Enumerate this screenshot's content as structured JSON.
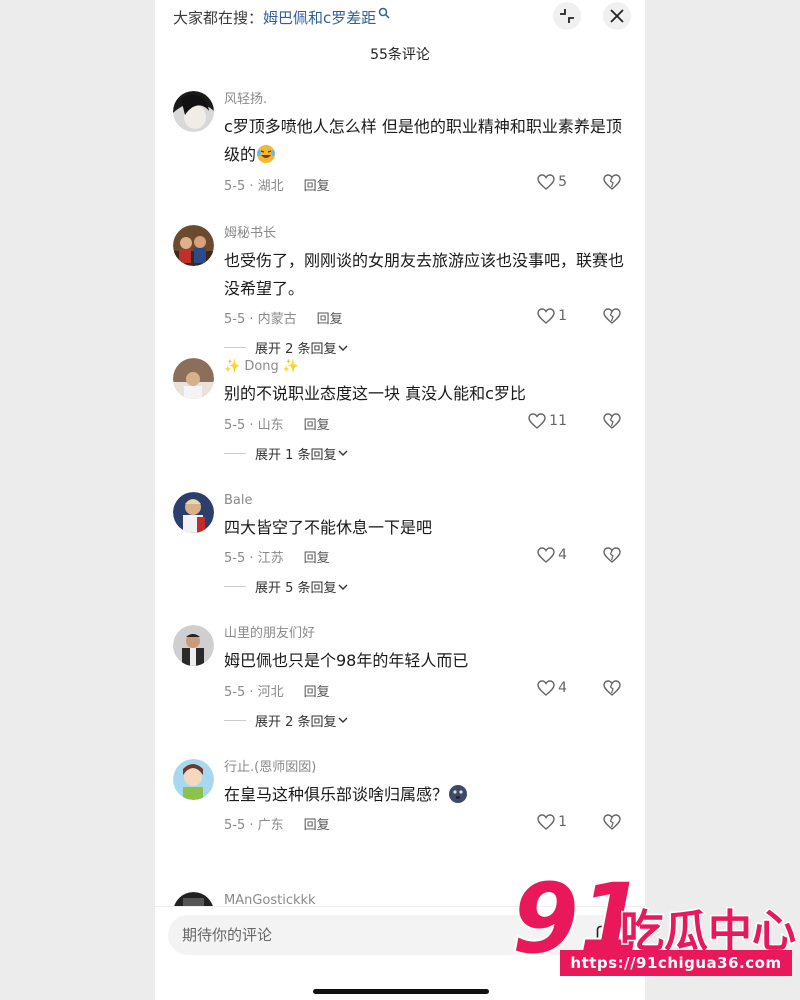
{
  "search": {
    "label": "大家都在搜：",
    "query": "姆巴佩和c罗差距"
  },
  "header": {
    "count": "55条评论"
  },
  "comments": [
    {
      "user": "风轻扬.",
      "text": "c罗顶多喷他人怎么样 但是他的职业精神和职业素养是顶级的",
      "emoji": "rofl-emoji",
      "date": "5-5 · 湖北",
      "reply": "回复",
      "likes": "5",
      "expand": ""
    },
    {
      "user": "姆秘书长",
      "text": "也受伤了，刚刚谈的女朋友去旅游应该也没事吧，联赛也没希望了。",
      "date": "5-5 · 内蒙古",
      "reply": "回复",
      "likes": "1",
      "expand": "展开 2 条回复"
    },
    {
      "user": "✨ Dong ✨",
      "text": "别的不说职业态度这一块 真没人能和c罗比",
      "date": "5-5 · 山东",
      "reply": "回复",
      "likes": "11",
      "expand": "展开 1 条回复"
    },
    {
      "user": "Bale",
      "text": "四大皆空了不能休息一下是吧",
      "date": "5-5 · 江苏",
      "reply": "回复",
      "likes": "4",
      "expand": "展开 5 条回复"
    },
    {
      "user": "山里的朋友们好",
      "text": "姆巴佩也只是个98年的年轻人而已",
      "date": "5-5 · 河北",
      "reply": "回复",
      "likes": "4",
      "expand": "展开 2 条回复"
    },
    {
      "user": "行止.(恩师囡囡)",
      "text": "在皇马这种俱乐部谈啥归属感？",
      "emoji": "dizzy-face-emoji",
      "date": "5-5 · 广东",
      "reply": "回复",
      "likes": "1",
      "expand": ""
    },
    {
      "user": "MAnGostickkk",
      "text": "",
      "date": "",
      "reply": "",
      "likes": "",
      "expand": ""
    }
  ],
  "input": {
    "placeholder": "期待你的评论"
  },
  "watermark": {
    "brand": "91吃瓜中心",
    "url": "https://91chigua36.com"
  },
  "colors": {
    "query": "#2f5f9e",
    "watermark": "#e8185a"
  }
}
